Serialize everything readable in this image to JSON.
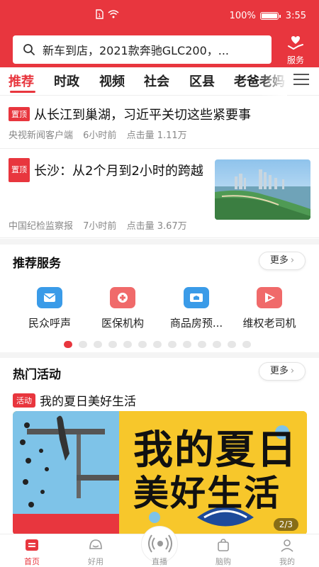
{
  "status": {
    "battery": "100%",
    "time": "3:55"
  },
  "header": {
    "search_text": "新车到店，2021款奔驰GLC200，...",
    "service_label": "服务"
  },
  "tabs": [
    {
      "label": "推荐",
      "active": true
    },
    {
      "label": "时政",
      "active": false
    },
    {
      "label": "视频",
      "active": false
    },
    {
      "label": "社会",
      "active": false
    },
    {
      "label": "区县",
      "active": false
    },
    {
      "label": "老爸老妈",
      "active": false
    }
  ],
  "news": [
    {
      "badge": "置顶",
      "title": "从长江到巢湖，习近平关切这些紧要事",
      "source": "央视新闻客户端",
      "time": "6小时前",
      "clicks": "点击量 1.11万"
    },
    {
      "badge": "置顶",
      "title": "长沙：从2个月到2小时的跨越",
      "source": "中国纪检监察报",
      "time": "7小时前",
      "clicks": "点击量 3.67万"
    }
  ],
  "services_section": {
    "title": "推荐服务",
    "more": "更多",
    "items": [
      {
        "label": "民众呼声",
        "icon": "mail-icon",
        "color": "#3a9be8"
      },
      {
        "label": "医保机构",
        "icon": "medical-plus-icon",
        "color": "#f06a6a"
      },
      {
        "label": "商品房预...",
        "icon": "house-card-icon",
        "color": "#3a9be8"
      },
      {
        "label": "维权老司机",
        "icon": "play-flag-icon",
        "color": "#f06a6a"
      }
    ],
    "pager": {
      "total": 13,
      "active": 0
    }
  },
  "activity_section": {
    "title": "热门活动",
    "more": "更多",
    "badge": "活动",
    "item_title": "我的夏日美好生活",
    "banner_text_line1": "我的夏日",
    "banner_text_line2": "美好生活",
    "banner_pager": "2/3"
  },
  "bottom_nav": [
    {
      "label": "首页",
      "active": true,
      "icon": "home-icon"
    },
    {
      "label": "好用",
      "active": false,
      "icon": "helmet-icon"
    },
    {
      "label": "直播",
      "active": false,
      "icon": "live-icon"
    },
    {
      "label": "脑购",
      "active": false,
      "icon": "bag-icon"
    },
    {
      "label": "我的",
      "active": false,
      "icon": "user-icon"
    }
  ],
  "colors": {
    "brand_red": "#e8363e",
    "text_gray": "#888888"
  }
}
